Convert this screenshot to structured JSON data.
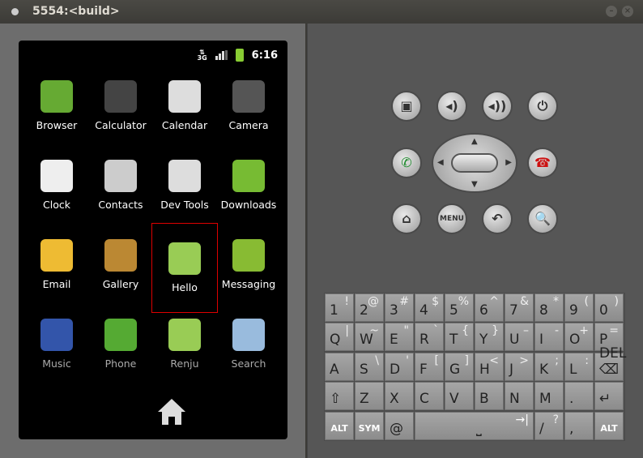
{
  "window": {
    "title": "5554:<build>"
  },
  "status": {
    "network": "3G",
    "time": "6:16",
    "battery_color": "#88cc33"
  },
  "apps": [
    {
      "label": "Browser",
      "icon": "globe-icon",
      "color": "#6a3"
    },
    {
      "label": "Calculator",
      "icon": "calculator-icon",
      "color": "#444"
    },
    {
      "label": "Calendar",
      "icon": "calendar-icon",
      "color": "#ddd"
    },
    {
      "label": "Camera",
      "icon": "camera-icon",
      "color": "#555"
    },
    {
      "label": "Clock",
      "icon": "clock-icon",
      "color": "#eee"
    },
    {
      "label": "Contacts",
      "icon": "contacts-icon",
      "color": "#ccc"
    },
    {
      "label": "Dev Tools",
      "icon": "gear-icon",
      "color": "#ddd"
    },
    {
      "label": "Downloads",
      "icon": "download-icon",
      "color": "#7b3"
    },
    {
      "label": "Email",
      "icon": "email-icon",
      "color": "#eb3"
    },
    {
      "label": "Gallery",
      "icon": "gallery-icon",
      "color": "#b83"
    },
    {
      "label": "Hello",
      "icon": "android-icon",
      "color": "#9c5",
      "selected": true
    },
    {
      "label": "Messaging",
      "icon": "message-icon",
      "color": "#8b3"
    },
    {
      "label": "Music",
      "icon": "music-icon",
      "color": "#35a"
    },
    {
      "label": "Phone",
      "icon": "phone-icon",
      "color": "#5a3"
    },
    {
      "label": "Renju",
      "icon": "android-icon",
      "color": "#9c5"
    },
    {
      "label": "Search",
      "icon": "search-icon",
      "color": "#9bd"
    }
  ],
  "controls": {
    "row1": [
      {
        "name": "camera-button",
        "glyph": "▣"
      },
      {
        "name": "volume-down-button",
        "glyph": "◂)"
      },
      {
        "name": "volume-up-button",
        "glyph": "◂))"
      },
      {
        "name": "power-button",
        "glyph": "⏻"
      }
    ],
    "call": {
      "glyph": "✆",
      "color": "#1a8a2a"
    },
    "endcall": {
      "glyph": "☎",
      "color": "#cc1111"
    },
    "row3": [
      {
        "name": "home-button",
        "glyph": "⌂"
      },
      {
        "name": "menu-button",
        "glyph": "MENU"
      },
      {
        "name": "back-button",
        "glyph": "↶"
      },
      {
        "name": "search-button",
        "glyph": "🔍"
      }
    ]
  },
  "keyboard": {
    "rows": [
      [
        [
          "1",
          "!"
        ],
        [
          "2",
          "@"
        ],
        [
          "3",
          "#"
        ],
        [
          "4",
          "$"
        ],
        [
          "5",
          "%"
        ],
        [
          "6",
          "^"
        ],
        [
          "7",
          "&"
        ],
        [
          "8",
          "*"
        ],
        [
          "9",
          "("
        ],
        [
          "0",
          ")"
        ]
      ],
      [
        [
          "Q",
          "|"
        ],
        [
          "W",
          "~"
        ],
        [
          "E",
          "\""
        ],
        [
          "R",
          "`"
        ],
        [
          "T",
          "{"
        ],
        [
          "Y",
          "}"
        ],
        [
          "U",
          "–"
        ],
        [
          "I",
          "-"
        ],
        [
          "O",
          "+"
        ],
        [
          "P",
          "="
        ]
      ],
      [
        [
          "A",
          ""
        ],
        [
          "S",
          "\\"
        ],
        [
          "D",
          "'"
        ],
        [
          "F",
          "["
        ],
        [
          "G",
          "]"
        ],
        [
          "H",
          "<"
        ],
        [
          "J",
          ">"
        ],
        [
          "K",
          ";"
        ],
        [
          "L",
          ":"
        ],
        [
          "DEL ⌫",
          ""
        ]
      ],
      [
        [
          "⇧",
          ""
        ],
        [
          "Z",
          ""
        ],
        [
          "X",
          ""
        ],
        [
          "C",
          ""
        ],
        [
          "V",
          ""
        ],
        [
          "B",
          ""
        ],
        [
          "N",
          ""
        ],
        [
          "M",
          ""
        ],
        [
          ".",
          ""
        ],
        [
          "↵",
          ""
        ]
      ]
    ],
    "bottom": {
      "alt": "ALT",
      "sym": "SYM",
      "at": "@",
      "space": "⎵",
      "tab": "→|",
      "slash": "/",
      "question": "?",
      "comma": ",",
      "alt2": "ALT"
    }
  }
}
